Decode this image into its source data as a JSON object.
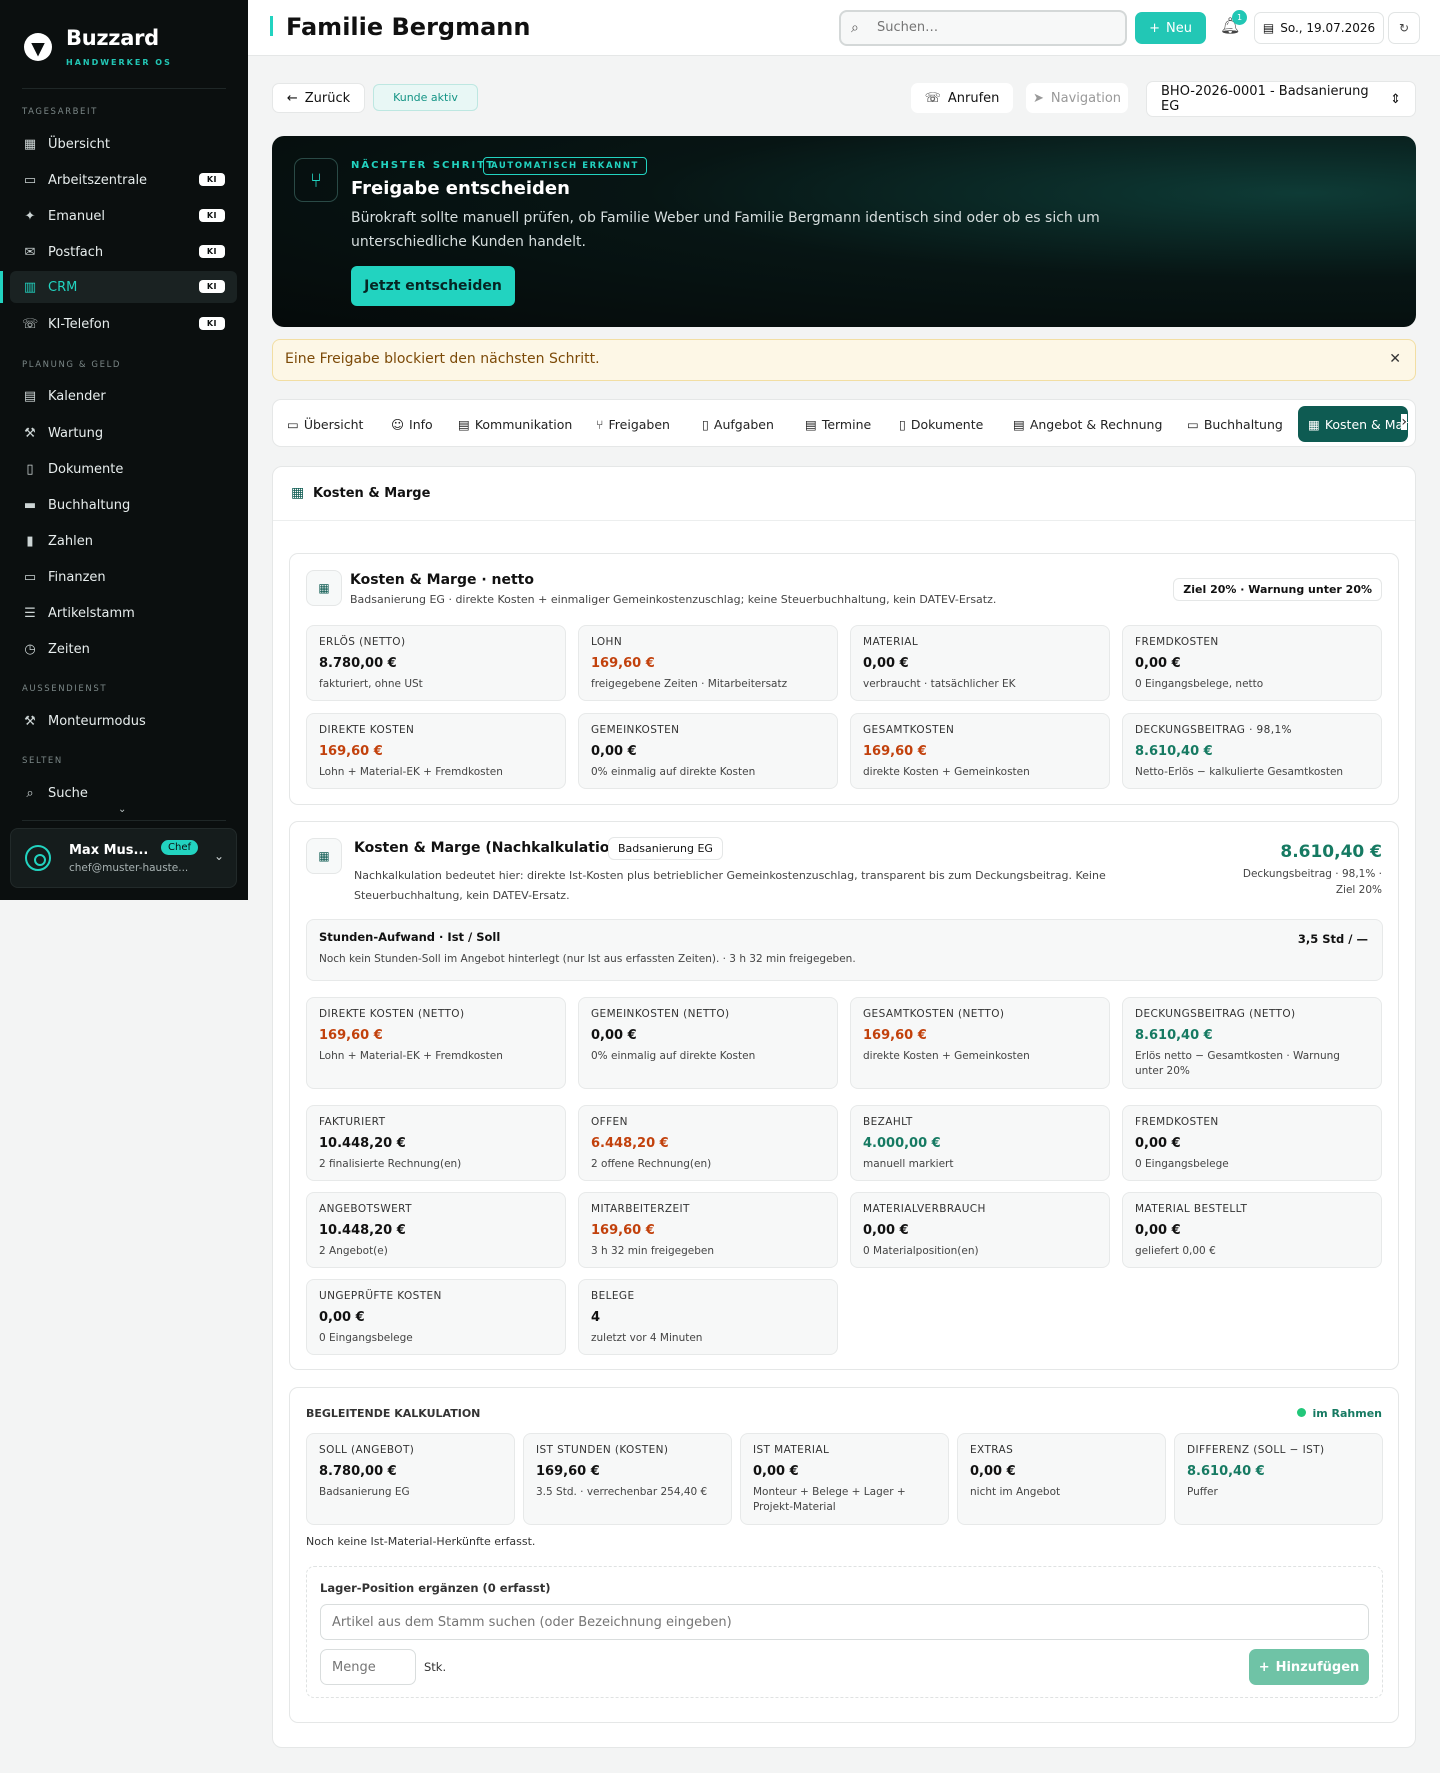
{
  "sidebar": {
    "brand": "Buzzard",
    "brand_sub": "HANDWERKER OS",
    "sections": {
      "tagesarbeit": "TAGESARBEIT",
      "planung": "PLANUNG & GELD",
      "aussendienst": "AUSSENDIENST",
      "selten": "SELTEN"
    },
    "items": [
      {
        "label": "Übersicht",
        "icon": "grid-icon"
      },
      {
        "label": "Arbeitszentrale",
        "icon": "inbox-icon",
        "badge": "KI"
      },
      {
        "label": "Emanuel",
        "icon": "sparkle-icon",
        "badge": "KI"
      },
      {
        "label": "Postfach",
        "icon": "mail-icon",
        "badge": "KI"
      },
      {
        "label": "CRM",
        "icon": "building-icon",
        "badge": "KI",
        "active": true
      },
      {
        "label": "KI-Telefon",
        "icon": "phone-icon",
        "badge": "KI"
      },
      {
        "label": "Kalender",
        "icon": "calendar-icon"
      },
      {
        "label": "Wartung",
        "icon": "wrench-icon"
      },
      {
        "label": "Dokumente",
        "icon": "file-icon"
      },
      {
        "label": "Buchhaltung",
        "icon": "ledger-icon"
      },
      {
        "label": "Zahlen",
        "icon": "chart-icon"
      },
      {
        "label": "Finanzen",
        "icon": "wallet-icon"
      },
      {
        "label": "Artikelstamm",
        "icon": "list-icon"
      },
      {
        "label": "Zeiten",
        "icon": "clock-icon"
      },
      {
        "label": "Monteurmodus",
        "icon": "hammer-icon"
      },
      {
        "label": "Suche",
        "icon": "search-icon"
      }
    ],
    "user": {
      "name": "Max Mus...",
      "role": "Chef",
      "email": "chef@muster-hauste..."
    }
  },
  "header": {
    "title": "Familie Bergmann",
    "search_placeholder": "Suchen…",
    "new_label": "Neu",
    "notifications": "1",
    "date": "So., 19.07.2026"
  },
  "actions": {
    "back": "Zurück",
    "status": "Kunde aktiv",
    "call": "Anrufen",
    "navigation": "Navigation",
    "project": "BHO-2026-0001 - Badsanierung EG"
  },
  "hero": {
    "kicker": "NÄCHSTER SCHRITT",
    "tag": "AUTOMATISCH ERKANNT",
    "title": "Freigabe entscheiden",
    "text": "Bürokraft sollte manuell prüfen, ob Familie Weber und Familie Bergmann identisch sind oder ob es sich um unterschiedliche Kunden handelt.",
    "button": "Jetzt entscheiden"
  },
  "warning": "Eine Freigabe blockiert den nächsten Schritt.",
  "tabs": [
    "Übersicht",
    "Info",
    "Kommunikation",
    "Freigaben",
    "Aufgaben",
    "Termine",
    "Dokumente",
    "Angebot & Rechnung",
    "Buchhaltung",
    "Kosten & Marge"
  ],
  "panel_title": "Kosten & Marge",
  "netto": {
    "title": "Kosten & Marge · netto",
    "subtitle": "Badsanierung EG · direkte Kosten + einmaliger Gemeinkostenzuschlag; keine Steuerbuchhaltung, kein DATEV-Ersatz.",
    "chip": "Ziel 20% · Warnung unter 20%",
    "boxes": [
      {
        "label": "ERLÖS (NETTO)",
        "value": "8.780,00 €",
        "hint": "fakturiert, ohne USt",
        "tone": ""
      },
      {
        "label": "LOHN",
        "value": "169,60 €",
        "hint": "freigegebene Zeiten · Mitarbeitersatz",
        "tone": "or"
      },
      {
        "label": "MATERIAL",
        "value": "0,00 €",
        "hint": "verbraucht · tatsächlicher EK",
        "tone": ""
      },
      {
        "label": "FREMDKOSTEN",
        "value": "0,00 €",
        "hint": "0 Eingangsbelege, netto",
        "tone": ""
      },
      {
        "label": "DIREKTE KOSTEN",
        "value": "169,60 €",
        "hint": "Lohn + Material-EK + Fremdkosten",
        "tone": "or"
      },
      {
        "label": "GEMEINKOSTEN",
        "value": "0,00 €",
        "hint": "0% einmalig auf direkte Kosten",
        "tone": ""
      },
      {
        "label": "GESAMTKOSTEN",
        "value": "169,60 €",
        "hint": "direkte Kosten + Gemeinkosten",
        "tone": "or"
      },
      {
        "label": "DECKUNGSBEITRAG · 98,1%",
        "value": "8.610,40 €",
        "hint": "Netto-Erlös − kalkulierte Gesamtkosten",
        "tone": "gr"
      }
    ]
  },
  "nachkalk": {
    "title": "Kosten & Marge (Nachkalkulation)",
    "chip": "Badsanierung EG",
    "text": "Nachkalkulation bedeutet hier: direkte Ist-Kosten plus betrieblicher Gemeinkostenzuschlag, transparent bis zum Deckungsbeitrag. Keine Steuerbuchhaltung, kein DATEV-Ersatz.",
    "big_value": "8.610,40 €",
    "big_note": "Deckungsbeitrag · 98,1% · Ziel 20%",
    "hours_title": "Stunden-Aufwand · Ist / Soll",
    "hours_value": "3,5 Std / —",
    "hours_note": "Noch kein Stunden-Soll im Angebot hinterlegt (nur Ist aus erfassten Zeiten). · 3 h 32 min freigegeben.",
    "boxes": [
      {
        "label": "DIREKTE KOSTEN (NETTO)",
        "value": "169,60 €",
        "hint": "Lohn + Material-EK + Fremdkosten",
        "tone": "or"
      },
      {
        "label": "GEMEINKOSTEN (NETTO)",
        "value": "0,00 €",
        "hint": "0% einmalig auf direkte Kosten",
        "tone": ""
      },
      {
        "label": "GESAMTKOSTEN (NETTO)",
        "value": "169,60 €",
        "hint": "direkte Kosten + Gemeinkosten",
        "tone": "or"
      },
      {
        "label": "DECKUNGSBEITRAG (NETTO)",
        "value": "8.610,40 €",
        "hint": "Erlös netto − Gesamtkosten · Warnung unter 20%",
        "tone": "gr"
      },
      {
        "label": "FAKTURIERT",
        "value": "10.448,20 €",
        "hint": "2 finalisierte Rechnung(en)",
        "tone": ""
      },
      {
        "label": "OFFEN",
        "value": "6.448,20 €",
        "hint": "2 offene Rechnung(en)",
        "tone": "or"
      },
      {
        "label": "BEZAHLT",
        "value": "4.000,00 €",
        "hint": "manuell markiert",
        "tone": "gr"
      },
      {
        "label": "FREMDKOSTEN",
        "value": "0,00 €",
        "hint": "0 Eingangsbelege",
        "tone": ""
      },
      {
        "label": "ANGEBOTSWERT",
        "value": "10.448,20 €",
        "hint": "2 Angebot(e)",
        "tone": ""
      },
      {
        "label": "MITARBEITERZEIT",
        "value": "169,60 €",
        "hint": "3 h 32 min freigegeben",
        "tone": "or"
      },
      {
        "label": "MATERIALVERBRAUCH",
        "value": "0,00 €",
        "hint": "0 Materialposition(en)",
        "tone": ""
      },
      {
        "label": "MATERIAL BESTELLT",
        "value": "0,00 €",
        "hint": "geliefert 0,00 €",
        "tone": ""
      },
      {
        "label": "UNGEPRÜFTE KOSTEN",
        "value": "0,00 €",
        "hint": "0 Eingangsbelege",
        "tone": ""
      },
      {
        "label": "BELEGE",
        "value": "4",
        "hint": "zuletzt vor 4 Minuten",
        "tone": ""
      }
    ]
  },
  "begleitend": {
    "title": "BEGLEITENDE KALKULATION",
    "status": "im Rahmen",
    "boxes": [
      {
        "label": "SOLL (ANGEBOT)",
        "value": "8.780,00 €",
        "hint": "Badsanierung EG",
        "tone": ""
      },
      {
        "label": "IST STUNDEN (KOSTEN)",
        "value": "169,60 €",
        "hint": "3.5 Std. · verrechenbar 254,40 €",
        "tone": ""
      },
      {
        "label": "IST MATERIAL",
        "value": "0,00 €",
        "hint": "Monteur + Belege + Lager + Projekt-Material",
        "tone": ""
      },
      {
        "label": "EXTRAS",
        "value": "0,00 €",
        "hint": "nicht im Angebot",
        "tone": ""
      },
      {
        "label": "DIFFERENZ (SOLL − IST)",
        "value": "8.610,40 €",
        "hint": "Puffer",
        "tone": "gr"
      }
    ],
    "note": "Noch keine Ist-Material-Herkünfte erfasst.",
    "form_title": "Lager-Position ergänzen (0 erfasst)",
    "article_placeholder": "Artikel aus dem Stamm suchen (oder Bezeichnung eingeben)",
    "qty_placeholder": "Menge",
    "unit": "Stk.",
    "add_label": "Hinzufügen"
  }
}
